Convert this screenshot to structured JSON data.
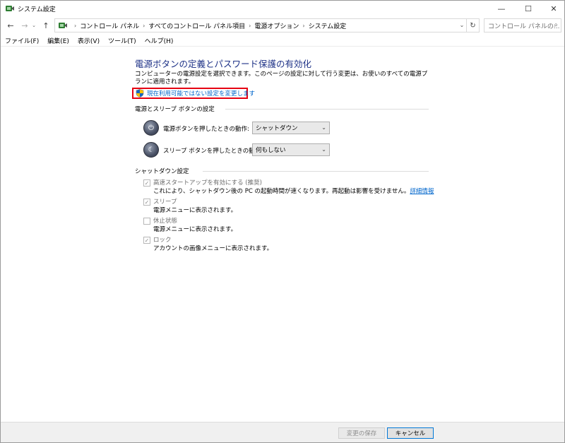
{
  "window": {
    "title": "システム設定",
    "controls": {
      "minimize": "—",
      "maximize": "☐",
      "close": "✕"
    }
  },
  "nav": {
    "back": "←",
    "forward": "→",
    "recent": "⌄",
    "up": "↑",
    "breadcrumb": [
      "コントロール パネル",
      "すべてのコントロール パネル項目",
      "電源オプション",
      "システム設定"
    ],
    "breadcrumb_sep": "›",
    "dropdown": "⌄",
    "refresh": "↻",
    "search_placeholder": "コントロール パネルの..."
  },
  "menu": [
    "ファイル(F)",
    "編集(E)",
    "表示(V)",
    "ツール(T)",
    "ヘルプ(H)"
  ],
  "content": {
    "title": "電源ボタンの定義とパスワード保護の有効化",
    "description": "コンピューターの電源設定を選択できます。このページの設定に対して行う変更は、お使いのすべての電源プランに適用されます。",
    "change_link": "現在利用可能ではない設定を変更します",
    "power_section": {
      "title": "電源とスリープ ボタンの設定",
      "rows": [
        {
          "label": "電源ボタンを押したときの動作:",
          "value": "シャットダウン"
        },
        {
          "label": "スリープ ボタンを押したときの動作:",
          "value": "何もしない"
        }
      ]
    },
    "shutdown_section": {
      "title": "シャットダウン設定",
      "items": [
        {
          "label": "高速スタートアップを有効にする (推奨)",
          "desc": "これにより、シャットダウン後の PC の起動時間が速くなります。再起動は影響を受けません。",
          "link": "詳細情報",
          "checked": true
        },
        {
          "label": "スリープ",
          "desc": "電源メニューに表示されます。",
          "checked": true
        },
        {
          "label": "休止状態",
          "desc": "電源メニューに表示されます。",
          "checked": false
        },
        {
          "label": "ロック",
          "desc": "アカウントの画像メニューに表示されます。",
          "checked": true
        }
      ]
    }
  },
  "footer": {
    "save_label": "変更の保存",
    "cancel_label": "キャンセル"
  },
  "colors": {
    "title_blue": "#1e3287",
    "link_blue": "#0066cc",
    "highlight_red": "#e60012"
  }
}
